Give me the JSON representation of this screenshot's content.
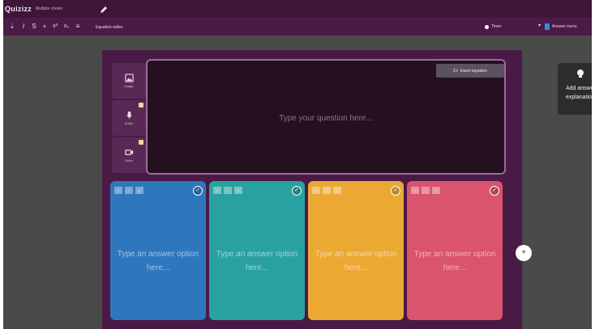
{
  "app": {
    "brand": "Quizizz",
    "mode": "Multiple choice"
  },
  "toolbar": {
    "tools": [
      "upload",
      "italic",
      "strikethrough",
      "bold-plus",
      "superscript",
      "subscript",
      "list"
    ],
    "math_label": "Equation editor",
    "timer_label": "Timer",
    "answer_mode_label": "Answer menu"
  },
  "media": [
    {
      "icon": "image-icon",
      "label": "Image"
    },
    {
      "icon": "mic-icon",
      "label": "Audio"
    },
    {
      "icon": "video-icon",
      "label": "Video"
    }
  ],
  "question": {
    "placeholder": "Type your question here...",
    "insert_equation": "Insert equation"
  },
  "answers": [
    {
      "placeholder": "Type an answer option here...",
      "color": "#2f77bd"
    },
    {
      "placeholder": "Type an answer option here...",
      "color": "#2aa1a1"
    },
    {
      "placeholder": "Type an answer option here...",
      "color": "#eba934"
    },
    {
      "placeholder": "Type an answer option here...",
      "color": "#d9546c"
    }
  ],
  "hint": {
    "line1": "Add answer",
    "line2": "explanation"
  },
  "colors": {
    "topbar": "#3d1538",
    "toolbar": "#4b1b45",
    "panel": "#4a1a46",
    "question_bg": "#25101f"
  }
}
